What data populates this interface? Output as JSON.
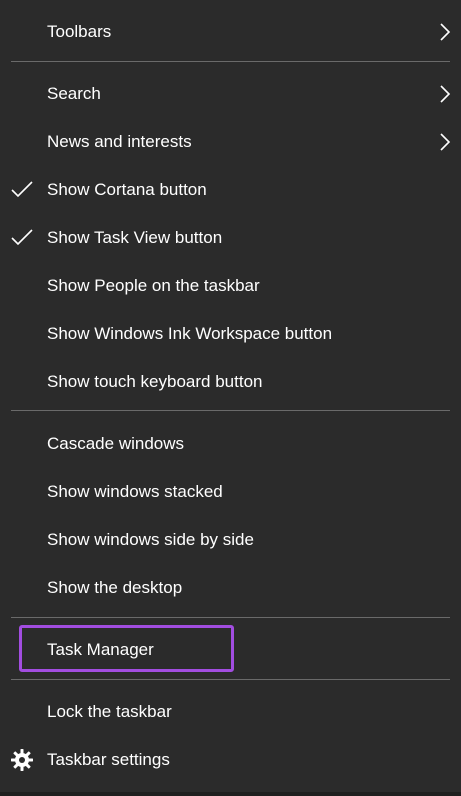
{
  "menu": {
    "items": [
      {
        "label": "Toolbars",
        "checked": false,
        "submenu": true
      },
      {
        "label": "Search",
        "checked": false,
        "submenu": true
      },
      {
        "label": "News and interests",
        "checked": false,
        "submenu": true
      },
      {
        "label": "Show Cortana button",
        "checked": true,
        "submenu": false
      },
      {
        "label": "Show Task View button",
        "checked": true,
        "submenu": false
      },
      {
        "label": "Show People on the taskbar",
        "checked": false,
        "submenu": false
      },
      {
        "label": "Show Windows Ink Workspace button",
        "checked": false,
        "submenu": false
      },
      {
        "label": "Show touch keyboard button",
        "checked": false,
        "submenu": false
      },
      {
        "label": "Cascade windows",
        "checked": false,
        "submenu": false
      },
      {
        "label": "Show windows stacked",
        "checked": false,
        "submenu": false
      },
      {
        "label": "Show windows side by side",
        "checked": false,
        "submenu": false
      },
      {
        "label": "Show the desktop",
        "checked": false,
        "submenu": false
      },
      {
        "label": "Task Manager",
        "checked": false,
        "submenu": false,
        "highlighted": true
      },
      {
        "label": "Lock the taskbar",
        "checked": false,
        "submenu": false
      },
      {
        "label": "Taskbar settings",
        "checked": false,
        "submenu": false,
        "icon": "gear-icon"
      }
    ]
  },
  "colors": {
    "background": "#2b2b2b",
    "text": "#ffffff",
    "separator": "#6a6a6a",
    "highlight_border": "#a24de0"
  }
}
